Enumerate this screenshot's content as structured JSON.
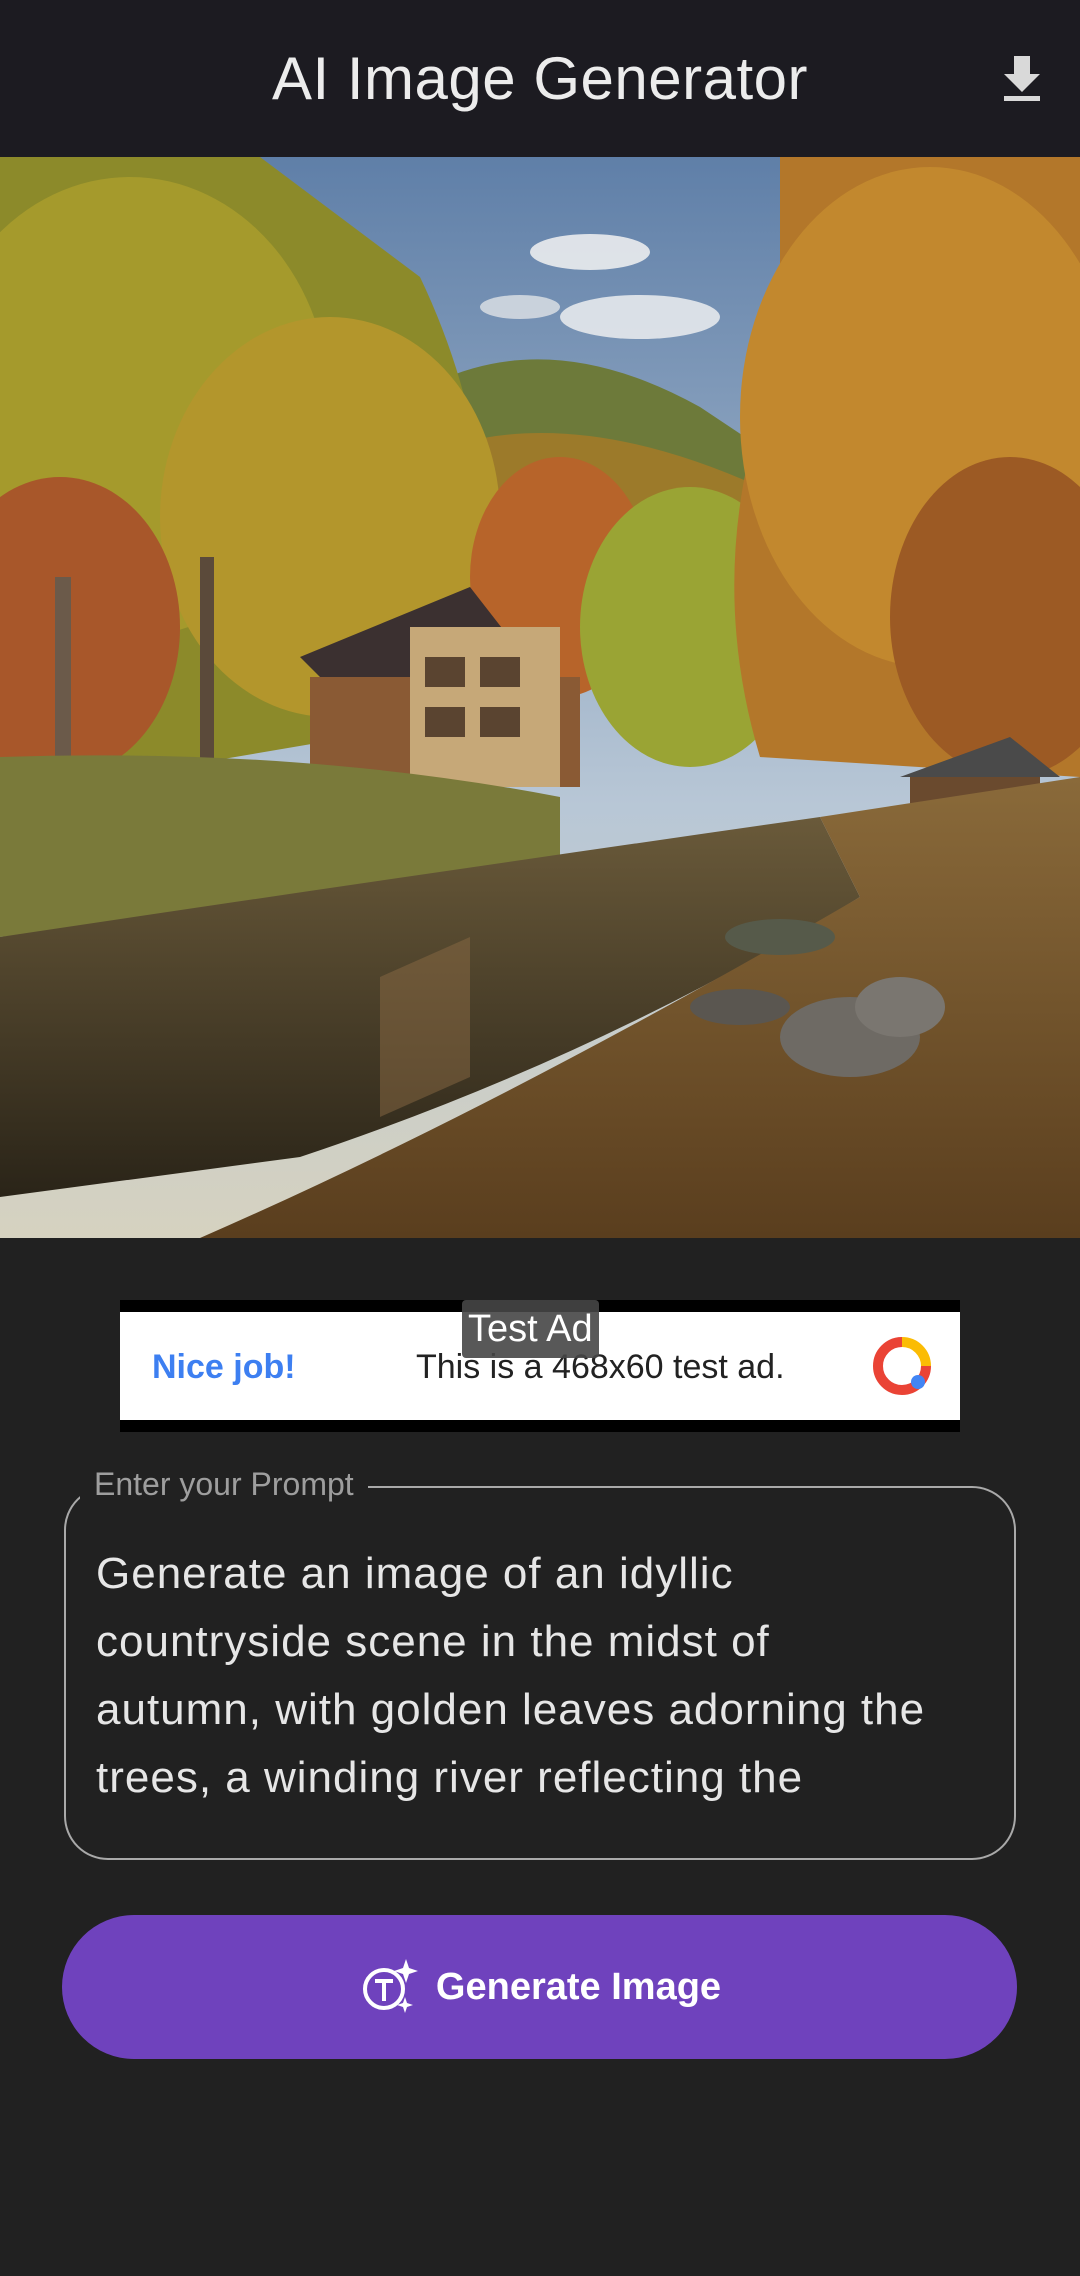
{
  "appbar": {
    "title": "AI Image Generator",
    "download_icon": "download-icon"
  },
  "generated_image": {
    "alt": "autumn countryside scene"
  },
  "ad": {
    "badge": "Test Ad",
    "headline": "Nice job!",
    "text": "This is a 468x60 test ad.",
    "logo_icon": "ad-logo-icon"
  },
  "prompt": {
    "label": "Enter your Prompt",
    "value": "Generate an image of an idyllic\ncountryside scene in the midst of\nautumn, with golden leaves adorning the\ntrees, a winding river reflecting the"
  },
  "generate_button": {
    "label": "Generate Image",
    "icon": "ai-sparkle-text-icon"
  },
  "colors": {
    "accent": "#6f42bd",
    "background": "#212121",
    "appbar": "#1c1b21"
  }
}
